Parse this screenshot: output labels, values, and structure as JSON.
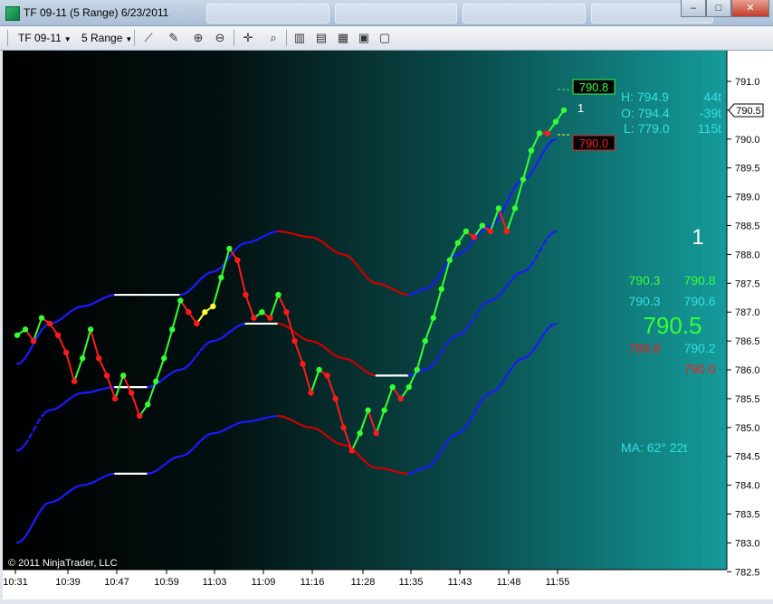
{
  "window": {
    "title": "TF 09-11 (5 Range)  6/23/2011"
  },
  "toolbar": {
    "instrument": "TF 09-11",
    "interval": "5 Range"
  },
  "info": {
    "high_label": "H: 794.9",
    "high_ticks": "44t",
    "open_label": "O: 794.4",
    "open_ticks": "-39t",
    "low_label": "L: 779.0",
    "low_ticks": "115t",
    "big_count": "1",
    "near_count": "1",
    "r1_left": "790.3",
    "r1_right": "790.8",
    "r2_left": "790.3",
    "r2_right": "790.6",
    "center_price": "790.5",
    "r3_left": "789.8",
    "r3_right": "790.2",
    "r4_right": "790.0",
    "ma_label": "MA: 62°  22t",
    "box_high": "790.8",
    "box_low": "790.0",
    "last_price": "790.5",
    "copyright": "© 2011 NinjaTrader, LLC"
  },
  "colors": {
    "up": "#33ff33",
    "down": "#ff1a1a",
    "neutral": "#ffff33",
    "band_up": "#1a1aff",
    "band_down": "#cc0000",
    "band_flat": "#ffffff"
  },
  "chart_data": {
    "type": "line",
    "y_axis": {
      "min": 782.5,
      "max": 791.0,
      "ticks": [
        791.0,
        790.5,
        790.0,
        789.5,
        789.0,
        788.5,
        788.0,
        787.5,
        787.0,
        786.5,
        786.0,
        785.5,
        785.0,
        784.5,
        784.0,
        783.5,
        783.0,
        782.5
      ]
    },
    "x_axis": {
      "labels": [
        "10:31",
        "10:39",
        "10:47",
        "10:59",
        "11:03",
        "11:09",
        "11:16",
        "11:28",
        "11:35",
        "11:43",
        "11:48",
        "11:55"
      ]
    },
    "price": [
      [
        0,
        786.6,
        "up"
      ],
      [
        1,
        786.7,
        "up"
      ],
      [
        2,
        786.5,
        "down"
      ],
      [
        3,
        786.9,
        "up"
      ],
      [
        4,
        786.8,
        "down"
      ],
      [
        5,
        786.6,
        "down"
      ],
      [
        6,
        786.3,
        "down"
      ],
      [
        7,
        785.8,
        "down"
      ],
      [
        8,
        786.2,
        "up"
      ],
      [
        9,
        786.7,
        "up"
      ],
      [
        10,
        786.2,
        "down"
      ],
      [
        11,
        785.9,
        "down"
      ],
      [
        12,
        785.5,
        "down"
      ],
      [
        13,
        785.9,
        "up"
      ],
      [
        14,
        785.6,
        "down"
      ],
      [
        15,
        785.2,
        "down"
      ],
      [
        16,
        785.4,
        "up"
      ],
      [
        17,
        785.8,
        "up"
      ],
      [
        18,
        786.2,
        "up"
      ],
      [
        19,
        786.7,
        "up"
      ],
      [
        20,
        787.2,
        "up"
      ],
      [
        21,
        787.0,
        "down"
      ],
      [
        22,
        786.8,
        "down"
      ],
      [
        23,
        787.0,
        "neutral"
      ],
      [
        24,
        787.1,
        "neutral"
      ],
      [
        25,
        787.6,
        "up"
      ],
      [
        26,
        788.1,
        "up"
      ],
      [
        27,
        787.9,
        "down"
      ],
      [
        28,
        787.3,
        "down"
      ],
      [
        29,
        786.9,
        "down"
      ],
      [
        30,
        787.0,
        "up"
      ],
      [
        31,
        786.9,
        "down"
      ],
      [
        32,
        787.3,
        "up"
      ],
      [
        33,
        787.0,
        "down"
      ],
      [
        34,
        786.5,
        "down"
      ],
      [
        35,
        786.1,
        "down"
      ],
      [
        36,
        785.6,
        "down"
      ],
      [
        37,
        786.0,
        "up"
      ],
      [
        38,
        785.9,
        "down"
      ],
      [
        39,
        785.5,
        "down"
      ],
      [
        40,
        785.0,
        "down"
      ],
      [
        41,
        784.6,
        "down"
      ],
      [
        42,
        784.9,
        "up"
      ],
      [
        43,
        785.3,
        "up"
      ],
      [
        44,
        784.9,
        "down"
      ],
      [
        45,
        785.3,
        "up"
      ],
      [
        46,
        785.7,
        "up"
      ],
      [
        47,
        785.5,
        "down"
      ],
      [
        48,
        785.7,
        "up"
      ],
      [
        49,
        786.0,
        "up"
      ],
      [
        50,
        786.5,
        "up"
      ],
      [
        51,
        786.9,
        "up"
      ],
      [
        52,
        787.4,
        "up"
      ],
      [
        53,
        787.9,
        "up"
      ],
      [
        54,
        788.2,
        "up"
      ],
      [
        55,
        788.4,
        "up"
      ],
      [
        56,
        788.3,
        "down"
      ],
      [
        57,
        788.5,
        "up"
      ],
      [
        58,
        788.4,
        "down"
      ],
      [
        59,
        788.8,
        "up"
      ],
      [
        60,
        788.4,
        "down"
      ],
      [
        61,
        788.8,
        "up"
      ],
      [
        62,
        789.3,
        "up"
      ],
      [
        63,
        789.8,
        "up"
      ],
      [
        64,
        790.1,
        "up"
      ],
      [
        65,
        790.1,
        "down"
      ],
      [
        66,
        790.3,
        "up"
      ],
      [
        67,
        790.5,
        "up"
      ]
    ],
    "upper_band": [
      [
        0,
        786.1
      ],
      [
        4,
        786.8
      ],
      [
        8,
        787.1
      ],
      [
        12,
        787.3
      ],
      [
        16,
        787.3
      ],
      [
        20,
        787.3
      ],
      [
        24,
        787.7
      ],
      [
        28,
        788.2
      ],
      [
        32,
        788.4
      ],
      [
        36,
        788.3
      ],
      [
        40,
        788.0
      ],
      [
        44,
        787.5
      ],
      [
        48,
        787.3
      ],
      [
        50,
        787.4
      ],
      [
        54,
        788.0
      ],
      [
        58,
        788.5
      ],
      [
        62,
        789.3
      ],
      [
        66,
        790.0
      ]
    ],
    "mid_band": [
      [
        0,
        784.6
      ],
      [
        4,
        785.3
      ],
      [
        8,
        785.6
      ],
      [
        12,
        785.7
      ],
      [
        16,
        785.7
      ],
      [
        20,
        786.0
      ],
      [
        24,
        786.5
      ],
      [
        28,
        786.8
      ],
      [
        32,
        786.8
      ],
      [
        36,
        786.5
      ],
      [
        40,
        786.2
      ],
      [
        44,
        785.9
      ],
      [
        48,
        785.9
      ],
      [
        50,
        786.0
      ],
      [
        54,
        786.6
      ],
      [
        58,
        787.2
      ],
      [
        62,
        787.7
      ],
      [
        66,
        788.4
      ]
    ],
    "lower_band": [
      [
        0,
        783.0
      ],
      [
        4,
        783.7
      ],
      [
        8,
        784.0
      ],
      [
        12,
        784.2
      ],
      [
        16,
        784.2
      ],
      [
        20,
        784.5
      ],
      [
        24,
        784.9
      ],
      [
        28,
        785.1
      ],
      [
        32,
        785.2
      ],
      [
        36,
        785.0
      ],
      [
        40,
        784.7
      ],
      [
        44,
        784.3
      ],
      [
        48,
        784.2
      ],
      [
        50,
        784.3
      ],
      [
        54,
        784.9
      ],
      [
        58,
        785.6
      ],
      [
        62,
        786.2
      ],
      [
        66,
        786.8
      ]
    ]
  }
}
